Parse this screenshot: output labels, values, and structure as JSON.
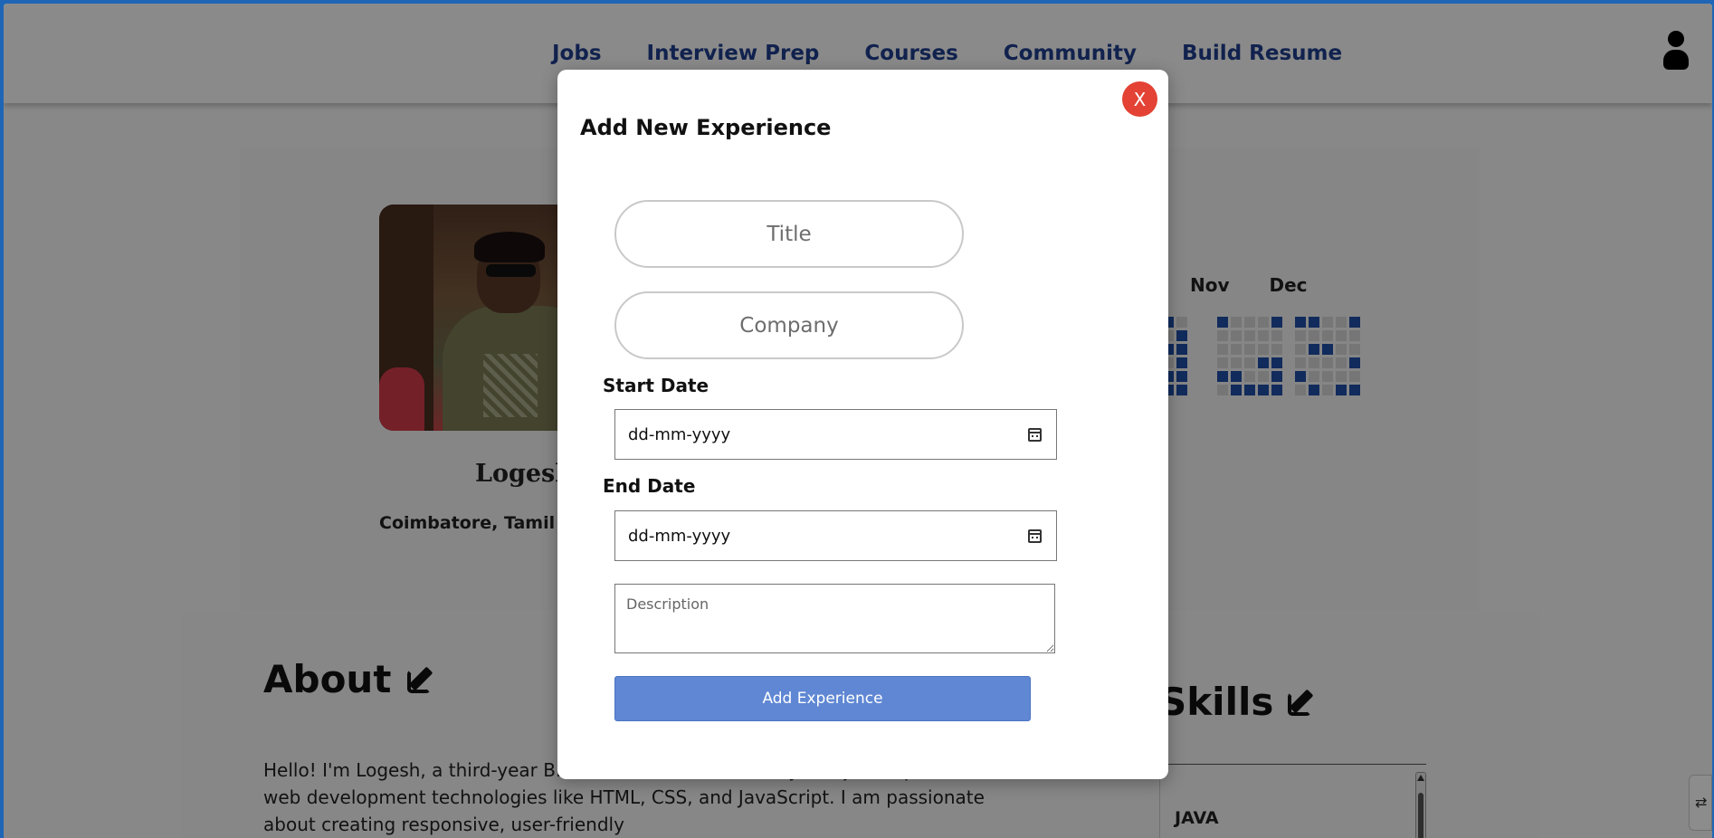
{
  "nav": {
    "links": [
      "Jobs",
      "Interview Prep",
      "Courses",
      "Community",
      "Build Resume"
    ],
    "user_icon": "user-icon"
  },
  "profile": {
    "name": "Logesh",
    "location": "Coimbatore, Tamil N",
    "heatmap_months": [
      "Nov",
      "Dec"
    ]
  },
  "about": {
    "title": "About",
    "text": "Hello! I'm Logesh, a third-year B.T... Professional University, Punjab. I specialize in web development technologies like HTML, CSS, and JavaScript. I am passionate about creating responsive, user-friendly"
  },
  "skills": {
    "title": "Skills",
    "items": [
      "JAVA"
    ]
  },
  "modal": {
    "close_label": "X",
    "title": "Add New Experience",
    "title_placeholder": "Title",
    "company_placeholder": "Company",
    "start_date_label": "Start Date",
    "start_date_value": "dd-mm-yyyy",
    "end_date_label": "End Date",
    "end_date_value": "dd-mm-yyyy",
    "description_placeholder": "Description",
    "submit_label": "Add Experience"
  },
  "colors": {
    "accent": "#5f87d3",
    "close": "#e34234",
    "nav": "#1f3f8f",
    "heat_on": "#1f4fa8"
  }
}
